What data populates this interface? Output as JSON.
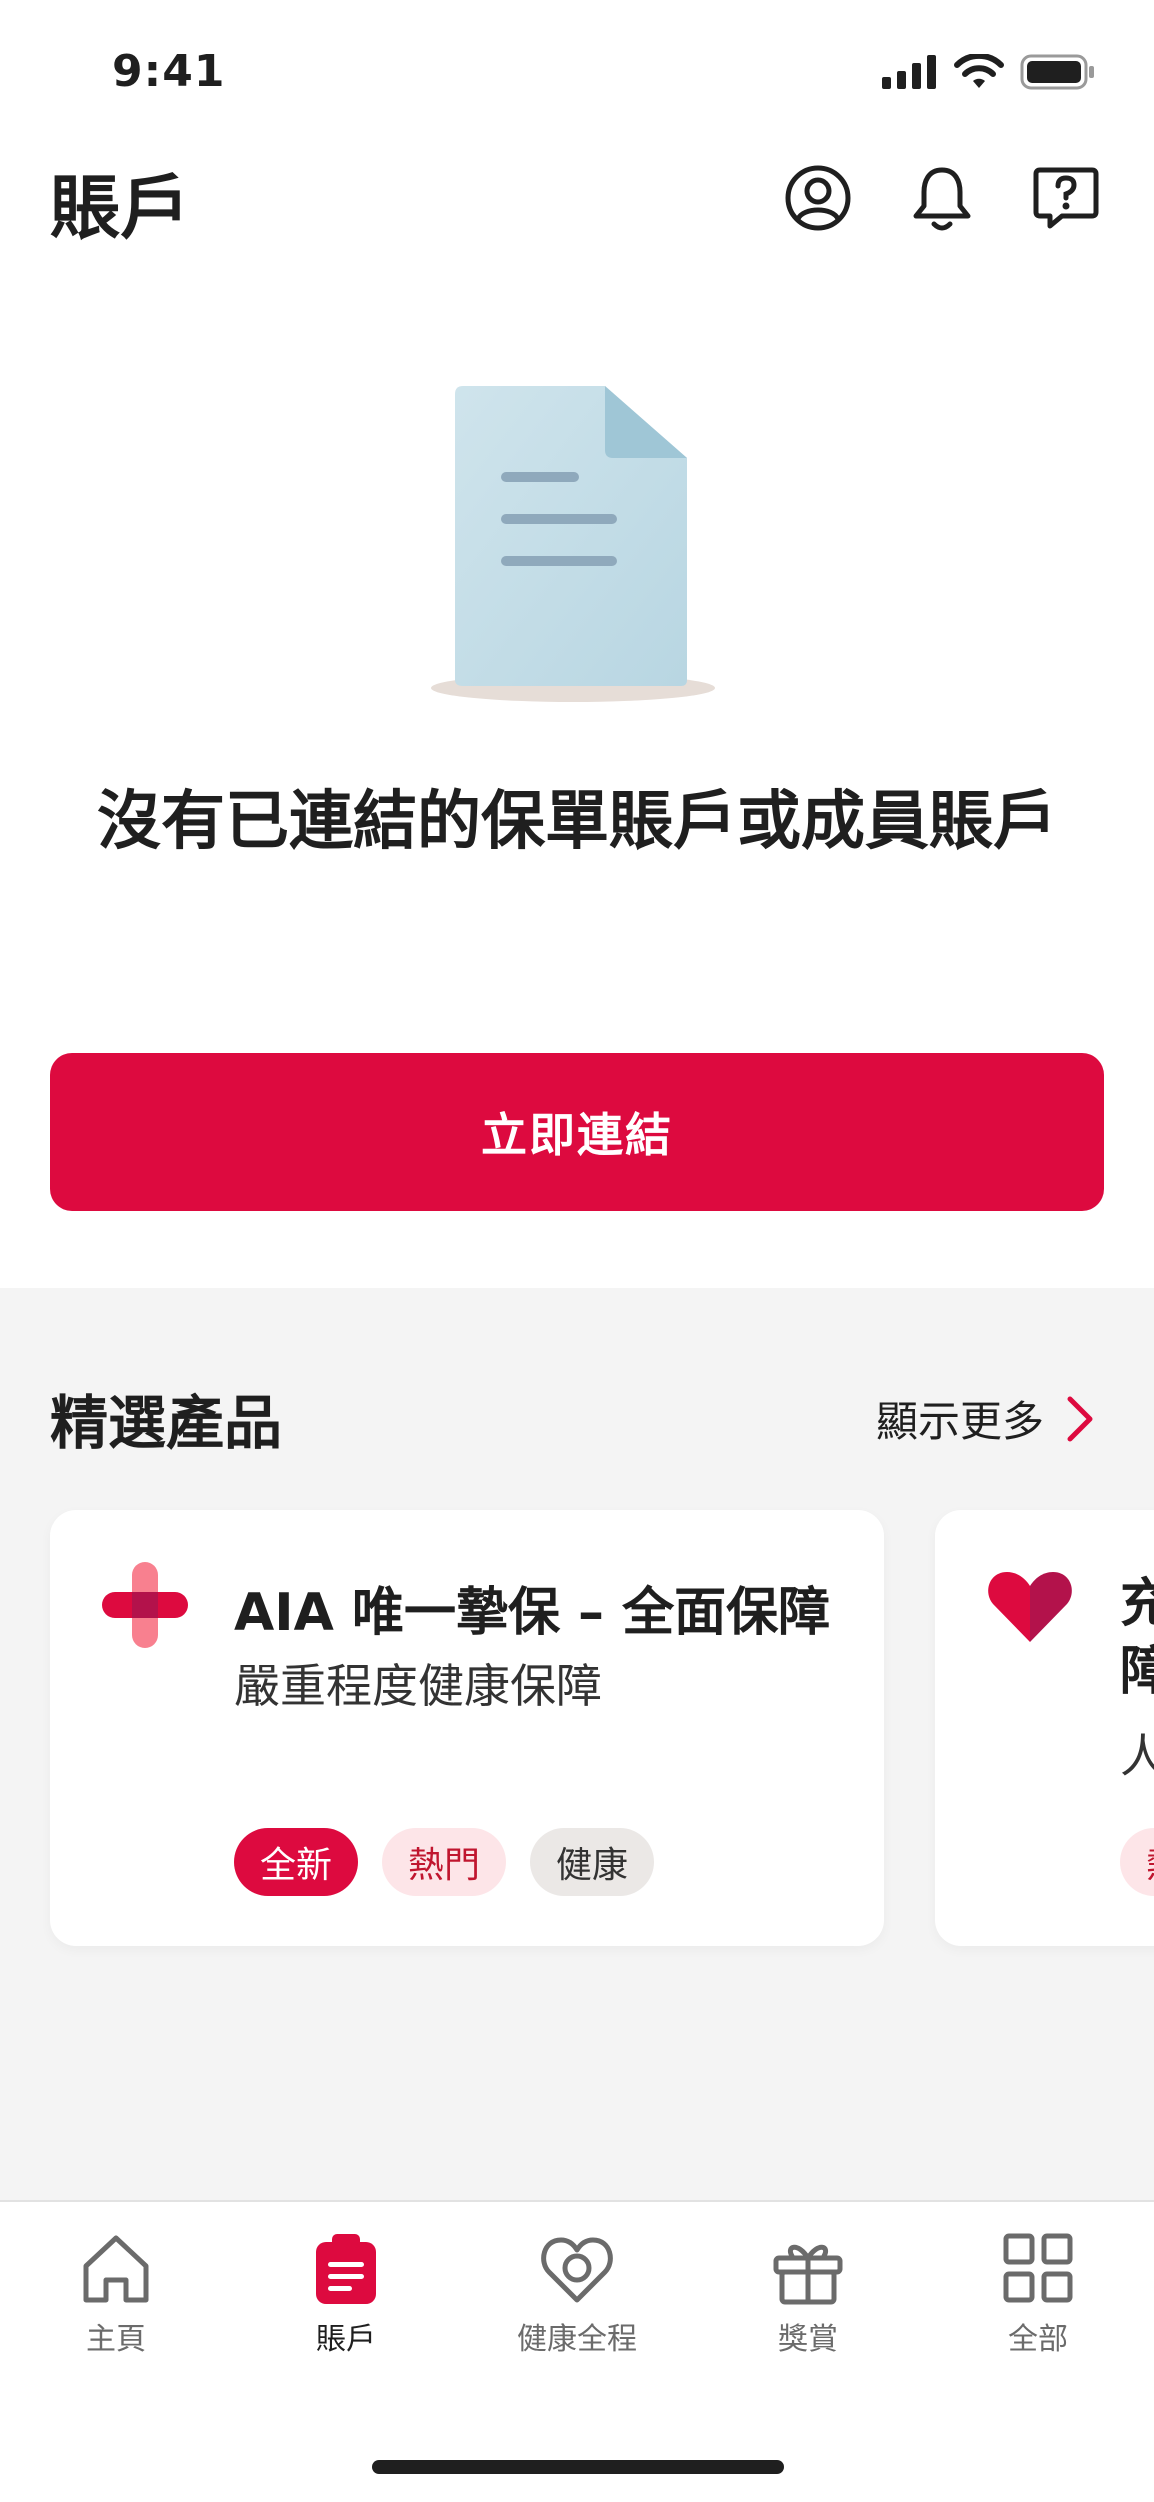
{
  "status_bar": {
    "time": "9:41"
  },
  "header": {
    "title": "賬戶"
  },
  "empty_state": {
    "message": "沒有已連結的保單賬戶或成員賬戶"
  },
  "primary_action": {
    "label": "立即連結"
  },
  "featured": {
    "title": "精選產品",
    "show_more": "顯示更多",
    "cards": [
      {
        "title": "AIA 唯一摯保 – 全面保障",
        "subtitle": "嚴重程度健康保障",
        "icon": "medical-cross-icon",
        "tags": [
          "全新",
          "熱門",
          "健康"
        ]
      },
      {
        "title_lines": [
          "充",
          "障"
        ],
        "subtitle": "人",
        "icon": "heart-icon",
        "tags": [
          "熱"
        ]
      }
    ]
  },
  "nav": {
    "items": [
      {
        "label": "主頁",
        "icon": "home-icon"
      },
      {
        "label": "賬戶",
        "icon": "account-icon",
        "active": true
      },
      {
        "label": "健康全程",
        "icon": "health-icon"
      },
      {
        "label": "獎賞",
        "icon": "gift-icon"
      },
      {
        "label": "全部",
        "icon": "grid-icon"
      }
    ]
  },
  "colors": {
    "accent": "#dd0a3f",
    "background_section": "#f4f4f4"
  }
}
